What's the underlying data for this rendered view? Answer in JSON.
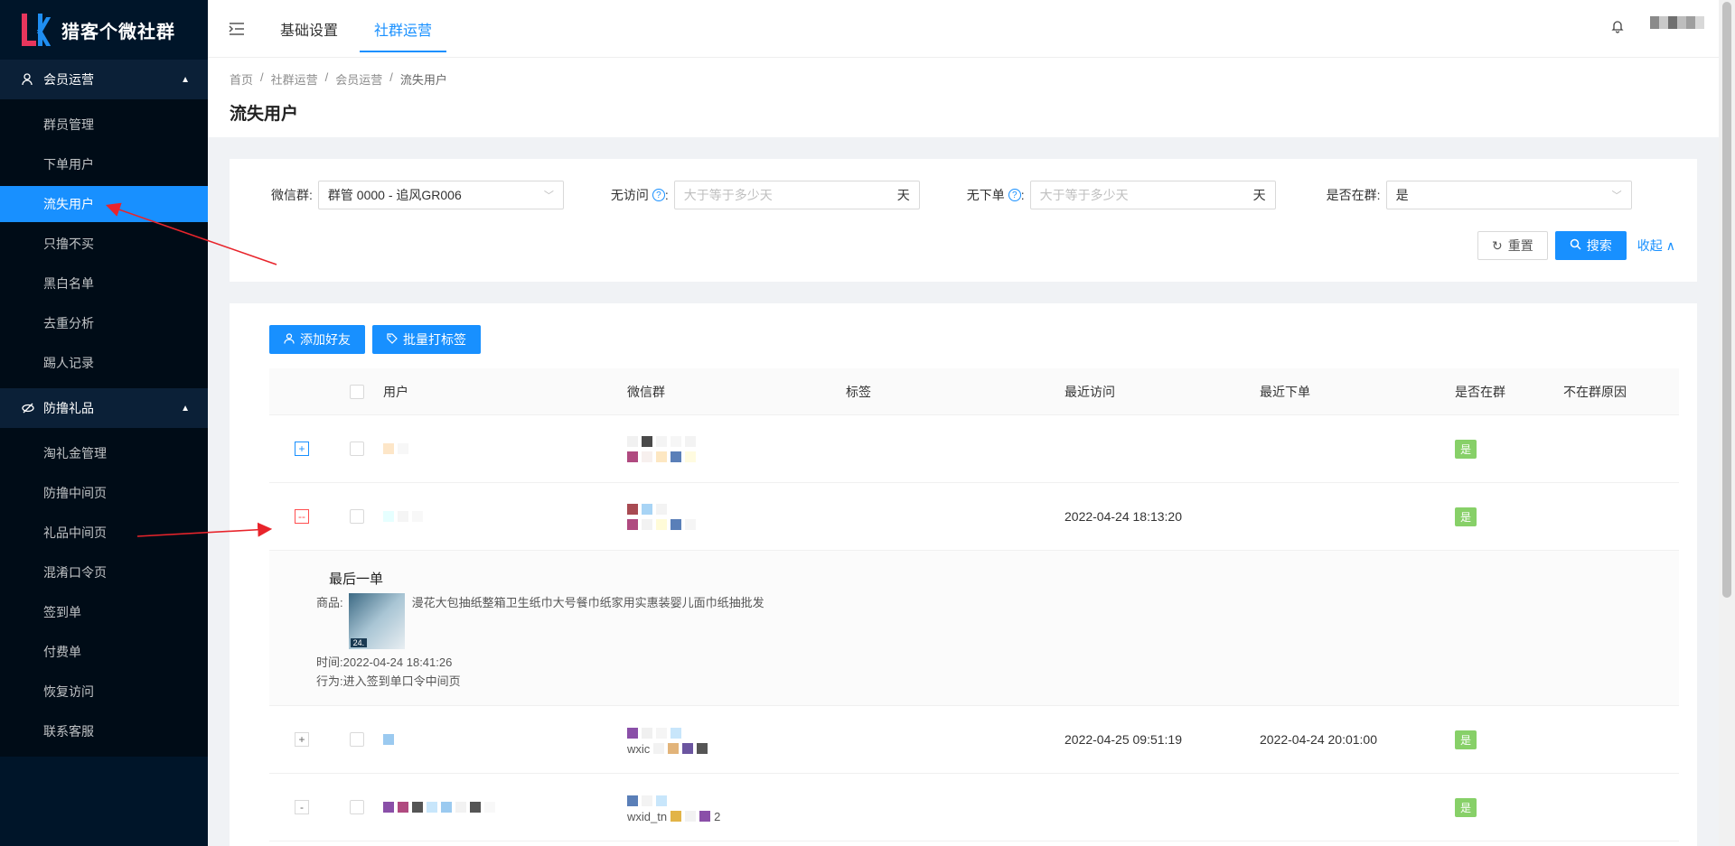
{
  "app": {
    "title": "猎客个微社群"
  },
  "sidebar": {
    "groups": [
      {
        "title": "会员运营",
        "items": [
          "群员管理",
          "下单用户",
          "流失用户",
          "只撸不买",
          "黑白名单",
          "去重分析",
          "踢人记录"
        ]
      },
      {
        "title": "防撸礼品",
        "items": [
          "淘礼金管理",
          "防撸中间页",
          "礼品中间页",
          "混淆口令页",
          "签到单",
          "付费单",
          "恢复访问",
          "联系客服"
        ]
      }
    ],
    "active_item": "流失用户"
  },
  "header": {
    "tabs": [
      "基础设置",
      "社群运营"
    ],
    "active_tab": "社群运营"
  },
  "breadcrumb": [
    "首页",
    "社群运营",
    "会员运营",
    "流失用户"
  ],
  "page_title": "流失用户",
  "filters": {
    "wechat_group_label": "微信群:",
    "wechat_group_value": "群管 0000 - 追风GR006",
    "no_visit_label": "无访问",
    "no_visit_placeholder": "大于等于多少天",
    "no_visit_unit": "天",
    "no_order_label": "无下单",
    "no_order_placeholder": "大于等于多少天",
    "no_order_unit": "天",
    "in_group_label": "是否在群:",
    "in_group_value": "是",
    "reset_label": "重置",
    "search_label": "搜索",
    "collapse_label": "收起"
  },
  "actions": {
    "add_friend": "添加好友",
    "batch_tag": "批量打标签"
  },
  "table": {
    "columns": [
      "用户",
      "微信群",
      "标签",
      "最近访问",
      "最近下单",
      "是否在群",
      "不在群原因"
    ],
    "rows": [
      {
        "recent_visit": "",
        "recent_order": "",
        "in_group": "是",
        "expander": "+"
      },
      {
        "recent_visit": "2022-04-24 18:13:20",
        "recent_order": "",
        "in_group": "是",
        "expander": "--"
      },
      {
        "recent_visit": "2022-04-25 09:51:19",
        "recent_order": "2022-04-24 20:01:00",
        "in_group": "是",
        "expander": "+",
        "group_text": "wxic"
      },
      {
        "recent_visit": "",
        "recent_order": "",
        "in_group": "是",
        "expander": "-",
        "group_text": "wxid_tn",
        "group_suffix": "2"
      }
    ],
    "expanded": {
      "title": "最后一单",
      "product_label": "商品:",
      "product_name": "漫花大包抽纸整箱卫生纸巾大号餐巾纸家用实惠装婴儿面巾纸抽批发",
      "thumb_text": "24.",
      "time_label": "时间:",
      "time_value": "2022-04-24 18:41:26",
      "action_label": "行为:",
      "action_value": "进入签到单口令中间页"
    }
  },
  "colors": {
    "sidebar_bg": "#001529",
    "primary": "#1890ff",
    "badge_green": "#87d068",
    "annotation_red": "#e8242b"
  }
}
